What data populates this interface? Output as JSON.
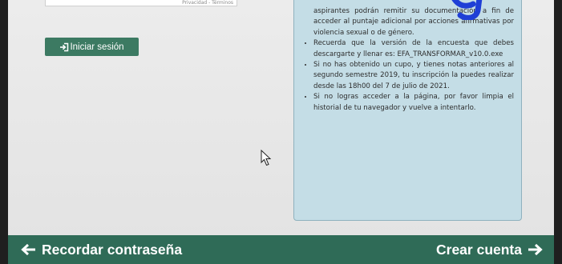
{
  "captcha": {
    "caption": "Privacidad - Términos"
  },
  "login": {
    "label": "Iniciar sesión",
    "icon": "sign-in-icon"
  },
  "info": {
    "items": [
      {
        "text": "aspirantes podrán remitir su documentación a fin de acceder al puntaje adicional por acciones afirmativas por violencia sexual o de género.",
        "bullet": false
      },
      {
        "text": "Recuerda que la versión de la encuesta que debes descargarte y llenar es: EFA_TRANSFORMAR_v10.0.exe",
        "bullet": true
      },
      {
        "text": "Si no has obtenido un cupo, y tienes notas anteriores al segundo semestre 2019, tu inscripción la puedes realizar desde las 18h00 del 7 de julio de 2021.",
        "bullet": true
      },
      {
        "text": "Si no logras acceder a la página, por favor limpia el historial de tu navegador y vuelve a intentarlo.",
        "bullet": true
      }
    ]
  },
  "footer": {
    "left_label": "Recordar contraseña",
    "left_icon": "arrow-left-icon",
    "right_label": "Crear cuenta",
    "right_icon": "arrow-right-icon"
  },
  "colors": {
    "accent": "#2f6b57",
    "button": "#3c7a62",
    "panel": "#c4dde6",
    "decoration": "#1f3fd6"
  }
}
